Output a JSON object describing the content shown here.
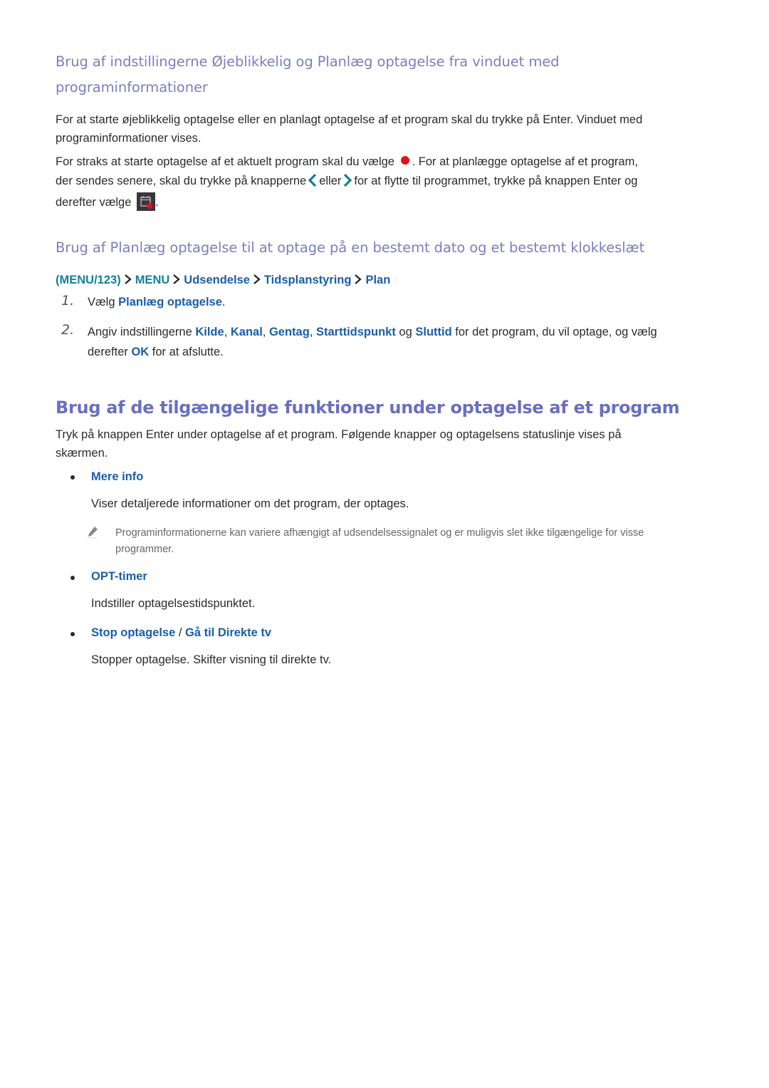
{
  "section1": {
    "heading_line1": "Brug af indstillingerne Øjeblikkelig og Planlæg optagelse fra vinduet med",
    "heading_line2": "programinformationer",
    "para1_line1": "For at starte øjeblikkelig optagelse eller en planlagt optagelse af et program skal du trykke på Enter. Vinduet med",
    "para1_line2": "programinformationer vises.",
    "para2_line1_a": "For straks at starte optagelse af et aktuelt program skal du vælge",
    "para2_line1_b": ". For at planlægge optagelse af et program,",
    "para2_line2_a": "der sendes senere, skal du trykke på knapperne",
    "para2_line2_b": "eller",
    "para2_line2_c": "for at flytte til programmet, trykke på knappen Enter og",
    "para2_line3_a": "derefter vælge",
    "para2_line3_b": "."
  },
  "section2": {
    "heading": "Brug af Planlæg optagelse til at optage på en bestemt dato og et bestemt klokkeslæt",
    "path": [
      "(MENU/123)",
      "MENU",
      "Udsendelse",
      "Tidsplanstyring",
      "Plan"
    ],
    "steps": [
      {
        "num": "1.",
        "prefix": "Vælg ",
        "link": "Planlæg optagelse",
        "suffix": "."
      },
      {
        "num": "2.",
        "prefix": "Angiv indstillingerne ",
        "links": [
          "Kilde",
          "Kanal",
          "Gentag",
          "Starttidspunkt",
          "Sluttid"
        ],
        "sep1": ", ",
        "og": " og ",
        "mid": " for det program, du vil optage, og vælg",
        "line2_prefix": "derefter ",
        "ok": "OK",
        "line2_suffix": " for at afslutte."
      }
    ]
  },
  "section3": {
    "heading": "Brug af de tilgængelige funktioner under optagelse af et program",
    "intro_line1": "Tryk på knappen Enter under optagelse af et program. Følgende knapper og optagelsens statuslinje vises på",
    "intro_line2": "skærmen.",
    "items": [
      {
        "title": "Mere info",
        "desc": "Viser detaljerede informationer om det program, der optages.",
        "note_line1": "Programinformationerne kan variere afhængigt af udsendelsessignalet og er muligvis slet ikke tilgængelige for visse",
        "note_line2": "programmer."
      },
      {
        "title": "OPT-timer",
        "desc": "Indstiller optagelsestidspunktet."
      },
      {
        "title_a": "Stop optagelse",
        "title_sep": " / ",
        "title_b": "Gå til Direkte tv",
        "desc": "Stopper optagelse. Skifter visning til direkte tv."
      }
    ]
  },
  "icons": {
    "record": "record-dot-icon",
    "left": "chevron-left-icon",
    "right": "chevron-right-icon",
    "schedule": "schedule-record-icon",
    "note": "pencil-note-icon",
    "breadcrumb_sep": "chevron-right-icon"
  },
  "colors": {
    "heading": "#7b7fbf",
    "heading_large": "#6a6fc0",
    "teal_link": "#157f9a",
    "blue_link": "#1a5ea8",
    "record_red": "#e3131b",
    "body_text": "#2b2b2b"
  }
}
